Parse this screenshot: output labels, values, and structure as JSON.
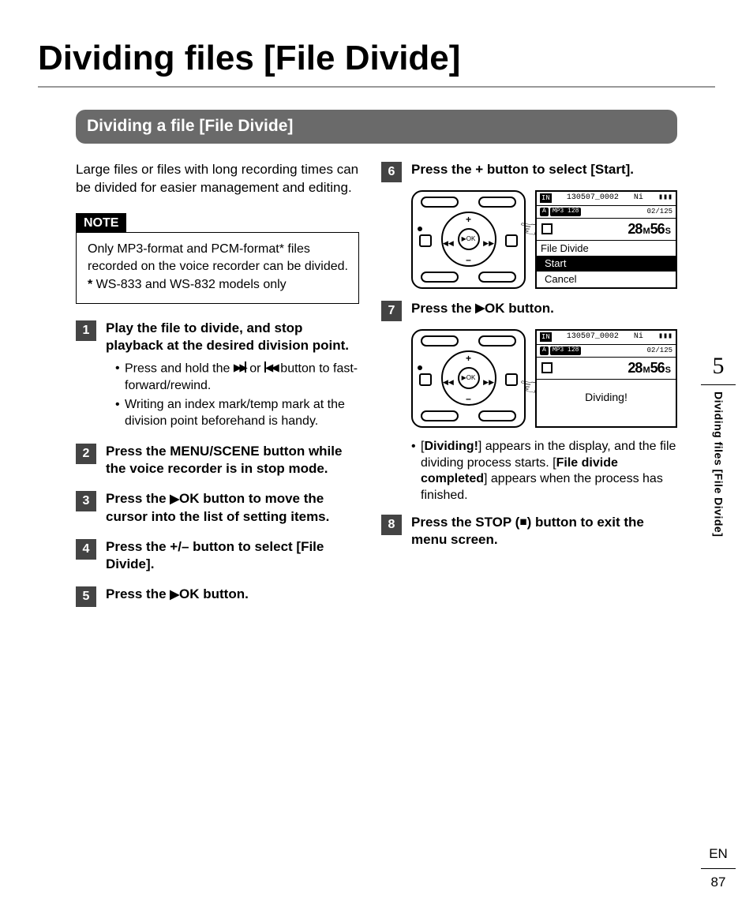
{
  "title": "Dividing files [File Divide]",
  "subheading": "Dividing a file [File Divide]",
  "intro": "Large files or files with long recording times can be divided for easier management and editing.",
  "note": {
    "label": "NOTE",
    "line1": "Only MP3-format and PCM-format* files recorded on the voice recorder can be divided.",
    "line2_prefix": "*",
    "line2": " WS-833 and WS-832 models only"
  },
  "steps": {
    "s1": {
      "num": "1",
      "title": "Play the file to divide, and stop playback at the desired division point.",
      "b1a": "Press and hold the ",
      "b1b": " or ",
      "b1c": " button to fast-forward/rewind.",
      "b2": "Writing an index mark/temp mark at the division point beforehand is handy."
    },
    "s2": {
      "num": "2",
      "t_a": "Press the ",
      "t_b": "MENU",
      "t_c": "/",
      "t_d": "SCENE",
      "t_e": " button while the voice recorder is in stop mode."
    },
    "s3": {
      "num": "3",
      "t_a": "Press the ",
      "t_b": "OK",
      "t_c": " button to move the cursor into the list of setting items."
    },
    "s4": {
      "num": "4",
      "t_a": "Press the ",
      "t_b": "+",
      "t_c": "/",
      "t_d": "–",
      "t_e": " button to select [",
      "t_f": "File Divide",
      "t_g": "]."
    },
    "s5": {
      "num": "5",
      "t_a": "Press the ",
      "t_b": "OK",
      "t_c": " button."
    },
    "s6": {
      "num": "6",
      "t_a": "Press the ",
      "t_b": "+",
      "t_c": " button to select [",
      "t_d": "Start",
      "t_e": "]."
    },
    "s7": {
      "num": "7",
      "t_a": "Press the ",
      "t_b": "OK",
      "t_c": " button.",
      "b1a": "[",
      "b1b": "Dividing!",
      "b1c": "] appears in the display, and the file dividing process starts. [",
      "b1d": "File divide completed",
      "b1e": "] appears when the process has finished."
    },
    "s8": {
      "num": "8",
      "t_a": "Press the ",
      "t_b": "STOP",
      "t_c": " (",
      "t_d": ") button to exit the menu screen."
    }
  },
  "lcd": {
    "top_file": "130507_0002",
    "top_right": "Ni",
    "folder": "A",
    "fmt": "MP3 128",
    "counter": "02/125",
    "time_m": "28",
    "time_s": "56",
    "menu_header": "File Divide",
    "menu_start": "Start",
    "menu_cancel": "Cancel",
    "dividing": "Dividing!"
  },
  "side": {
    "chapter": "5",
    "section": "Dividing files [File Divide]"
  },
  "footer": {
    "lang": "EN",
    "page": "87"
  },
  "chart_data": null
}
